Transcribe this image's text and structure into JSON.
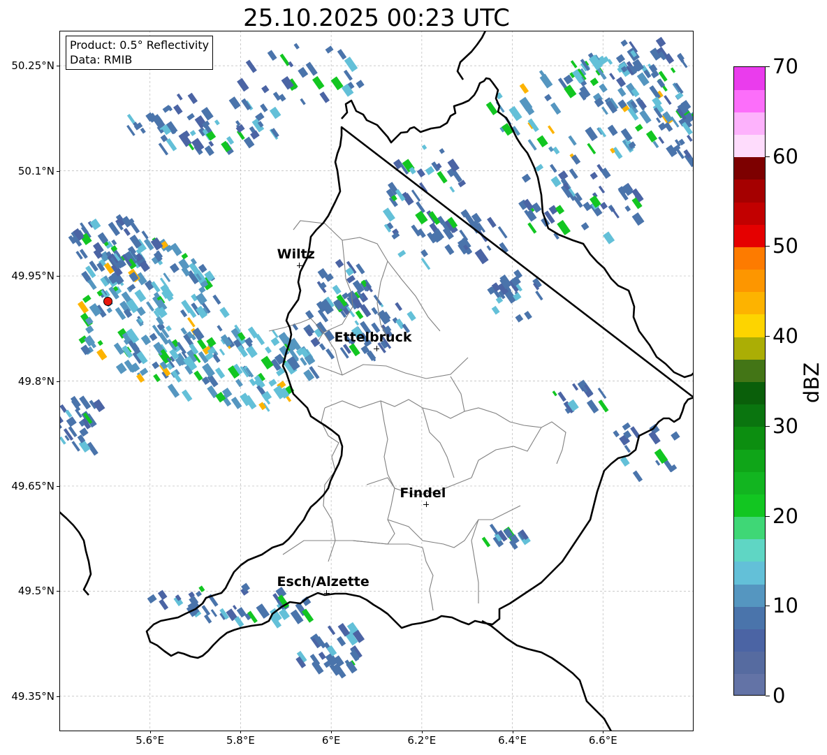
{
  "title": "25.10.2025 00:23 UTC",
  "info": {
    "product": "Product: 0.5° Reflectivity",
    "data": "Data: RMIB"
  },
  "map": {
    "lat_ticks": [
      "50.25°N",
      "50.1°N",
      "49.95°N",
      "49.8°N",
      "49.65°N",
      "49.5°N",
      "49.35°N"
    ],
    "lon_ticks": [
      "5.6°E",
      "5.8°E",
      "6°E",
      "6.2°E",
      "6.4°E",
      "6.6°E"
    ],
    "extent": {
      "lon_min": 5.4,
      "lon_max": 6.8,
      "lat_min": 49.3,
      "lat_max": 50.3
    },
    "cities": [
      {
        "name": "Wiltz",
        "lon": 5.93,
        "lat": 49.965
      },
      {
        "name": "Ettelbruck",
        "lon": 6.1,
        "lat": 49.846
      },
      {
        "name": "Findel",
        "lon": 6.21,
        "lat": 49.624
      },
      {
        "name": "Esch/Alzette",
        "lon": 5.99,
        "lat": 49.497
      }
    ],
    "radar_site": {
      "lon": 5.506,
      "lat": 49.914
    }
  },
  "colorbar": {
    "label": "dBZ",
    "min": 0,
    "max": 70,
    "tick_labels": [
      "0",
      "10",
      "20",
      "30",
      "40",
      "50",
      "60",
      "70"
    ],
    "colors": [
      "#6373a6",
      "#566ba0",
      "#4b64a4",
      "#4a74ab",
      "#5596c0",
      "#63c0d8",
      "#5fd6c4",
      "#3fd776",
      "#12c621",
      "#12b520",
      "#0fa518",
      "#0c8e10",
      "#0a750f",
      "#0a5f0a",
      "#437516",
      "#abae05",
      "#fdd400",
      "#fdb300",
      "#fd9600",
      "#fd7b00",
      "#e50000",
      "#c20000",
      "#a50000",
      "#7d0000",
      "#fedcfc",
      "#fdb2fc",
      "#fc6efa",
      "#ea3ced"
    ]
  }
}
